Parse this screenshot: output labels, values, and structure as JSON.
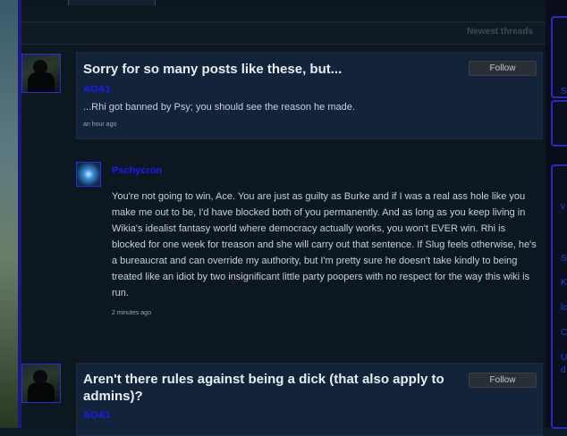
{
  "header": {
    "newest_threads": "Newest threads"
  },
  "threads": [
    {
      "title": "Sorry for so many posts like these, but...",
      "author": "AOA1",
      "excerpt": "...Rhi got banned by Psy; you should see the reason he made.",
      "timestamp": "an hour ago",
      "follow_label": "Follow",
      "reply": {
        "author": "Pschycron",
        "text": "You're not going to win, Ace. You are just as guilty as Burke and if I was a real ass hole like you make me out to be, I'd have blocked both of you permanently. And as long as you keep living in Wikia's idealist fantasy world where democracy actually works, you won't EVER win. Rhi is blocked for one week for treason and she will carry out that sentence. If Slug feels otherwise, he's a bureaucrat and can override my authority, but I'm pretty sure he doesn't take kindly to being treated like an idiot by two insignificant little party poopers with no respect for the way this wiki is run.",
        "timestamp": "2 minutes ago"
      }
    },
    {
      "title": "Aren't there rules against being a dick (that also apply to admins)?",
      "author": "AOA1",
      "follow_label": "Follow"
    }
  ],
  "right_rail": {
    "letters": [
      "S",
      "v",
      "S",
      "K",
      "lc",
      "C",
      "U",
      "d"
    ]
  },
  "colors": {
    "author_link": "#1a1aff",
    "border_accent": "#2a2ae0",
    "card_bg": "#12233a"
  }
}
